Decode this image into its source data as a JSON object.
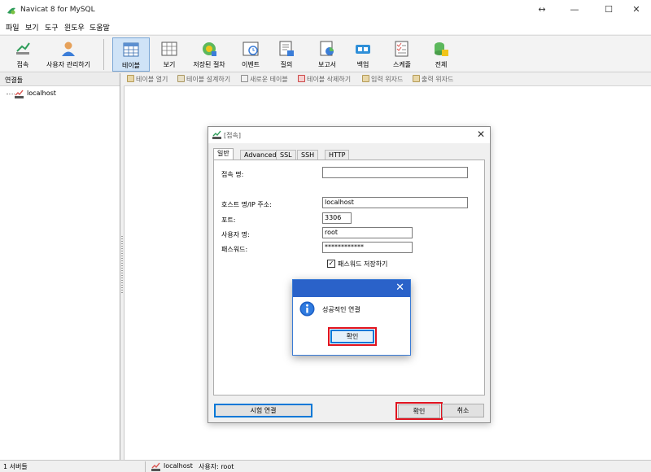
{
  "window": {
    "title": "Navicat 8 for MySQL",
    "controls": {
      "minimize": "—",
      "maximize": "☐",
      "close": "✕",
      "extra": "↔"
    }
  },
  "menu": [
    {
      "label": "파일"
    },
    {
      "label": "보기"
    },
    {
      "label": "도구"
    },
    {
      "label": "윈도우"
    },
    {
      "label": "도움말"
    }
  ],
  "toolbar": {
    "buttons": [
      {
        "label": "접속",
        "icon": "connect-icon"
      },
      {
        "label": "사용자 관리하기",
        "icon": "user-manager-icon"
      },
      {
        "label": "테이블",
        "icon": "table-icon",
        "active": true
      },
      {
        "label": "보기",
        "icon": "view-icon"
      },
      {
        "label": "저장된 절차",
        "icon": "stored-procedure-icon"
      },
      {
        "label": "이벤트",
        "icon": "event-icon"
      },
      {
        "label": "질의",
        "icon": "query-icon"
      },
      {
        "label": "보고서",
        "icon": "report-icon"
      },
      {
        "label": "백업",
        "icon": "backup-icon"
      },
      {
        "label": "스케쥴",
        "icon": "schedule-icon"
      },
      {
        "label": "전체",
        "icon": "all-icon"
      }
    ]
  },
  "sidebar": {
    "header": "연결들",
    "items": [
      {
        "label": "localhost"
      }
    ]
  },
  "subtoolbar": {
    "buttons": [
      {
        "label": "테이블 열기"
      },
      {
        "label": "테이블 설계하기"
      },
      {
        "label": "새로운 테이블"
      },
      {
        "label": "테이블 삭제하기"
      },
      {
        "label": "입력 위자드"
      },
      {
        "label": "출력 위자드"
      }
    ]
  },
  "statusbar": {
    "servers": "1 서버들",
    "host": "localhost",
    "user": "사용자: root"
  },
  "dialog": {
    "title": "[접속]",
    "tabs": [
      "일반",
      "Advanced",
      "SSL",
      "SSH",
      "HTTP"
    ],
    "fields": {
      "conn_name_label": "접속 명:",
      "conn_name_value": "",
      "host_label": "호스트 명/IP 주소:",
      "host_value": "localhost",
      "port_label": "포트:",
      "port_value": "3306",
      "user_label": "사용자 명:",
      "user_value": "root",
      "password_label": "패스워드:",
      "password_value": "************",
      "save_password_label": "패스워드 저장하기",
      "save_password_checked": "✓"
    },
    "buttons": {
      "test": "시험 연결",
      "ok": "확인",
      "cancel": "취소"
    }
  },
  "messagebox": {
    "text": "성공적인 연결",
    "ok": "확인",
    "close": "✕"
  },
  "colors": {
    "accent": "#0078d7",
    "highlight": "#e0131f",
    "msg_title": "#2a62c9"
  }
}
